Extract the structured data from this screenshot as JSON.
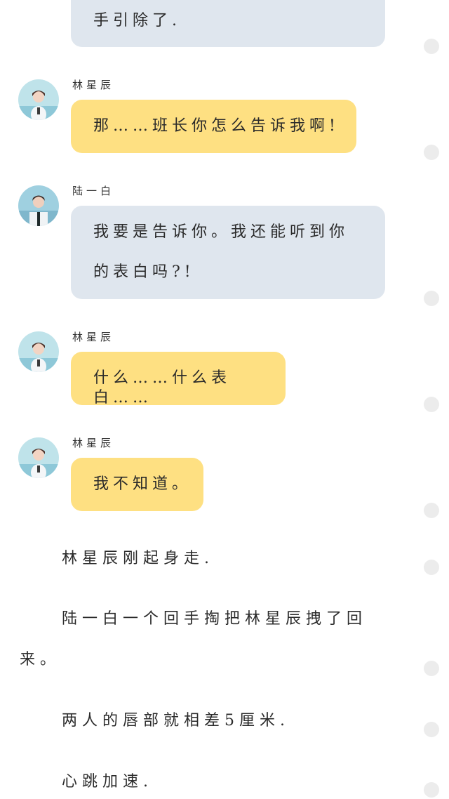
{
  "messages": [
    {
      "speaker": "",
      "text": "手引除了.",
      "style": "blue"
    },
    {
      "speaker": "林星辰",
      "text": "那……班长你怎么告诉我啊!",
      "style": "yellow"
    },
    {
      "speaker": "陆一白",
      "text_line1": "我要是告诉你。我还能听到你",
      "text_line2": "的表白吗?!",
      "style": "blue"
    },
    {
      "speaker": "林星辰",
      "text": "什么……什么表白……",
      "style": "yellow"
    },
    {
      "speaker": "林星辰",
      "text": "我不知道。",
      "style": "yellow"
    }
  ],
  "narration": [
    {
      "text": "林星辰刚起身走."
    },
    {
      "text_line1": "陆一白一个回手掏把林星辰拽了回",
      "text_line2": "来。"
    },
    {
      "text": "两人的唇部就相差5厘米."
    },
    {
      "text": "心跳加速."
    }
  ],
  "colors": {
    "yellow_bubble": "#fee082",
    "blue_bubble": "#dfe6ee",
    "scroll_dot": "#ececec"
  }
}
